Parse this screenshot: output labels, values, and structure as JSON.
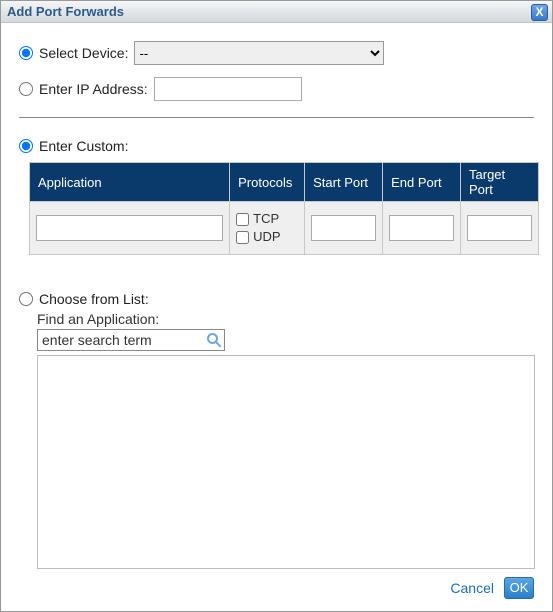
{
  "dialog": {
    "title": "Add Port Forwards"
  },
  "device": {
    "radio_label": "Select Device:",
    "selected_option": "--",
    "ip_radio_label": "Enter IP Address:",
    "ip_value": ""
  },
  "custom": {
    "radio_label": "Enter Custom:",
    "headers": {
      "application": "Application",
      "protocols": "Protocols",
      "start_port": "Start Port",
      "end_port": "End Port",
      "target_port": "Target Port"
    },
    "row": {
      "application": "",
      "tcp_label": "TCP",
      "udp_label": "UDP",
      "start_port": "",
      "end_port": "",
      "target_port": ""
    }
  },
  "choose": {
    "radio_label": "Choose from List:",
    "find_label": "Find an Application:",
    "search_value": "enter search term"
  },
  "footer": {
    "cancel": "Cancel",
    "ok": "OK"
  }
}
